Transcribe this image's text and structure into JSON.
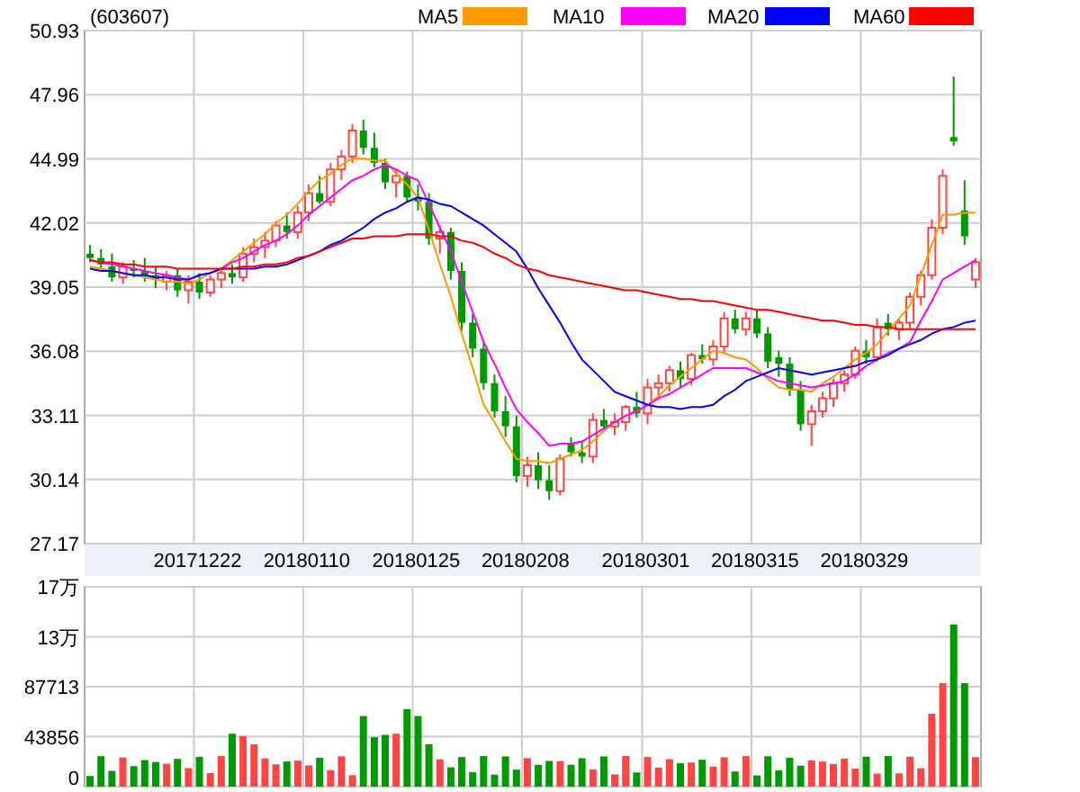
{
  "title": "(603607)",
  "price_chart": {
    "chart_data": {
      "type": "candlestick",
      "ylim": [
        27.17,
        50.93
      ],
      "grid": true,
      "categories": [
        null,
        null,
        null,
        null,
        null,
        null,
        null,
        null,
        null,
        null,
        "20171222",
        null,
        null,
        null,
        null,
        null,
        null,
        null,
        null,
        null,
        "20180110",
        null,
        null,
        null,
        null,
        null,
        null,
        null,
        null,
        null,
        "20180125",
        null,
        null,
        null,
        null,
        null,
        null,
        null,
        null,
        null,
        "20180208",
        null,
        null,
        null,
        null,
        null,
        null,
        null,
        null,
        null,
        null,
        "20180301",
        null,
        null,
        null,
        null,
        null,
        null,
        null,
        null,
        null,
        "20180315",
        null,
        null,
        null,
        null,
        null,
        null,
        null,
        null,
        null,
        "20180329",
        null,
        null,
        null,
        null,
        null,
        null,
        null,
        null,
        null,
        null
      ],
      "yticks": [
        {
          "value": 50.93,
          "label": "50.93"
        },
        {
          "value": 47.96,
          "label": "47.96"
        },
        {
          "value": 44.99,
          "label": "44.99"
        },
        {
          "value": 42.02,
          "label": "42.02"
        },
        {
          "value": 39.05,
          "label": "39.05"
        },
        {
          "value": 36.08,
          "label": "36.08"
        },
        {
          "value": 33.11,
          "label": "33.11"
        },
        {
          "value": 30.14,
          "label": "30.14"
        },
        {
          "value": 27.17,
          "label": "27.17"
        }
      ],
      "ohlc": [
        [
          40.6,
          41.0,
          40.2,
          40.4
        ],
        [
          40.4,
          40.8,
          39.9,
          40.1
        ],
        [
          40.0,
          40.6,
          39.3,
          39.5
        ],
        [
          39.5,
          40.2,
          39.2,
          40.0
        ],
        [
          39.9,
          40.3,
          39.5,
          39.8
        ],
        [
          39.8,
          40.4,
          39.3,
          39.6
        ],
        [
          39.6,
          40.0,
          39.0,
          39.4
        ],
        [
          39.3,
          39.8,
          38.9,
          39.6
        ],
        [
          39.6,
          39.9,
          38.6,
          38.9
        ],
        [
          38.9,
          39.6,
          38.3,
          39.3
        ],
        [
          39.3,
          39.7,
          38.5,
          38.8
        ],
        [
          38.8,
          39.6,
          38.6,
          39.4
        ],
        [
          39.4,
          39.9,
          39.0,
          39.7
        ],
        [
          39.7,
          40.1,
          39.2,
          39.5
        ],
        [
          39.5,
          40.9,
          39.3,
          40.6
        ],
        [
          40.6,
          41.3,
          40.2,
          40.9
        ],
        [
          40.9,
          41.6,
          40.4,
          41.2
        ],
        [
          41.2,
          42.1,
          40.9,
          41.9
        ],
        [
          41.9,
          42.5,
          41.3,
          41.6
        ],
        [
          41.6,
          42.8,
          41.3,
          42.5
        ],
        [
          42.5,
          43.8,
          42.1,
          43.4
        ],
        [
          43.4,
          44.2,
          42.9,
          43.0
        ],
        [
          43.0,
          44.8,
          42.8,
          44.5
        ],
        [
          44.5,
          45.4,
          44.0,
          45.1
        ],
        [
          45.1,
          46.6,
          44.8,
          46.3
        ],
        [
          46.3,
          46.8,
          45.2,
          45.5
        ],
        [
          45.5,
          46.2,
          44.6,
          44.8
        ],
        [
          44.8,
          45.0,
          43.6,
          43.9
        ],
        [
          43.9,
          44.5,
          43.2,
          44.2
        ],
        [
          44.2,
          44.4,
          43.0,
          43.2
        ],
        [
          43.2,
          43.8,
          42.6,
          43.0
        ],
        [
          43.0,
          43.4,
          41.0,
          41.3
        ],
        [
          41.3,
          41.9,
          40.6,
          41.6
        ],
        [
          41.6,
          41.8,
          39.4,
          39.8
        ],
        [
          39.8,
          40.2,
          37.0,
          37.4
        ],
        [
          37.4,
          37.8,
          35.8,
          36.2
        ],
        [
          36.2,
          36.6,
          34.3,
          34.6
        ],
        [
          34.6,
          35.0,
          33.0,
          33.3
        ],
        [
          33.3,
          34.0,
          32.1,
          32.6
        ],
        [
          32.6,
          33.1,
          30.0,
          30.3
        ],
        [
          30.3,
          31.2,
          29.8,
          30.8
        ],
        [
          30.8,
          31.4,
          29.7,
          30.1
        ],
        [
          30.1,
          30.8,
          29.2,
          29.6
        ],
        [
          29.6,
          31.3,
          29.4,
          31.1
        ],
        [
          31.8,
          32.1,
          31.2,
          31.4
        ],
        [
          31.4,
          31.9,
          30.9,
          31.2
        ],
        [
          31.2,
          33.2,
          30.9,
          32.9
        ],
        [
          32.9,
          33.4,
          32.4,
          32.6
        ],
        [
          32.6,
          33.2,
          32.2,
          32.8
        ],
        [
          32.8,
          33.6,
          32.4,
          33.5
        ],
        [
          33.5,
          34.2,
          33.0,
          33.2
        ],
        [
          33.2,
          34.8,
          32.7,
          34.4
        ],
        [
          34.4,
          35.0,
          33.9,
          34.6
        ],
        [
          34.6,
          35.4,
          34.2,
          35.2
        ],
        [
          35.2,
          35.6,
          34.4,
          34.8
        ],
        [
          34.8,
          36.0,
          34.5,
          35.9
        ],
        [
          35.9,
          36.4,
          35.5,
          35.7
        ],
        [
          35.7,
          36.6,
          35.4,
          36.3
        ],
        [
          36.3,
          37.9,
          36.0,
          37.6
        ],
        [
          37.6,
          38.0,
          36.9,
          37.1
        ],
        [
          37.1,
          37.9,
          36.8,
          37.6
        ],
        [
          37.6,
          38.0,
          36.7,
          36.9
        ],
        [
          36.9,
          37.2,
          35.3,
          35.6
        ],
        [
          35.8,
          36.1,
          34.9,
          35.5
        ],
        [
          35.5,
          35.8,
          34.0,
          34.3
        ],
        [
          34.3,
          34.7,
          32.4,
          32.7
        ],
        [
          32.7,
          33.6,
          31.7,
          33.3
        ],
        [
          33.3,
          34.2,
          33.0,
          33.9
        ],
        [
          33.9,
          34.8,
          33.5,
          34.6
        ],
        [
          34.6,
          35.2,
          34.2,
          35.0
        ],
        [
          35.0,
          36.3,
          34.8,
          36.1
        ],
        [
          36.1,
          36.6,
          35.5,
          35.8
        ],
        [
          35.8,
          37.6,
          35.6,
          37.2
        ],
        [
          37.4,
          37.8,
          36.8,
          37.1
        ],
        [
          37.1,
          37.6,
          36.6,
          37.4
        ],
        [
          37.4,
          38.8,
          37.1,
          38.6
        ],
        [
          38.6,
          39.8,
          38.2,
          39.6
        ],
        [
          39.6,
          42.2,
          39.4,
          41.8
        ],
        [
          41.8,
          44.5,
          41.5,
          44.2
        ],
        [
          46.0,
          48.8,
          45.6,
          45.8
        ],
        [
          42.6,
          44.0,
          41.0,
          41.4
        ],
        [
          39.4,
          40.4,
          39.0,
          40.2
        ]
      ]
    }
  },
  "moving_averages": {
    "chart_data": {
      "type": "line",
      "ylim": [
        27.17,
        50.93
      ],
      "legend": true,
      "series": [
        {
          "name": "MA5",
          "color": "#ff9900",
          "values": [
            40.0,
            39.9,
            39.8,
            39.7,
            39.6,
            39.5,
            39.4,
            39.3,
            39.3,
            39.2,
            39.4,
            39.7,
            39.9,
            40.3,
            40.7,
            41.1,
            41.5,
            42.0,
            42.4,
            42.9,
            43.5,
            44.0,
            44.3,
            44.7,
            45.0,
            45.0,
            44.9,
            44.9,
            44.3,
            43.8,
            43.2,
            41.7,
            40.1,
            38.6,
            36.9,
            35.3,
            33.6,
            32.8,
            31.9,
            31.1,
            31.0,
            31.0,
            30.9,
            31.1,
            31.3,
            31.5,
            31.9,
            32.4,
            32.8,
            33.1,
            33.3,
            33.6,
            34.0,
            34.5,
            34.9,
            35.3,
            35.7,
            36.1,
            36.0,
            35.8,
            35.7,
            35.3,
            34.8,
            34.4,
            34.3,
            34.3,
            34.2,
            34.6,
            34.9,
            35.3,
            35.7,
            36.0,
            36.4,
            37.0,
            37.6,
            38.2,
            39.6,
            41.0,
            42.4,
            42.4,
            42.5,
            42.5
          ]
        },
        {
          "name": "MA10",
          "color": "#ff00ff",
          "values": [
            40.3,
            40.2,
            40.1,
            40.0,
            39.9,
            39.8,
            39.7,
            39.6,
            39.5,
            39.4,
            39.6,
            39.7,
            39.9,
            40.2,
            40.4,
            40.7,
            41.0,
            41.2,
            41.5,
            41.9,
            42.4,
            42.8,
            43.2,
            43.6,
            44.0,
            44.2,
            44.5,
            44.7,
            44.5,
            44.2,
            44.0,
            42.9,
            41.8,
            40.7,
            39.3,
            37.9,
            36.5,
            35.5,
            34.4,
            33.4,
            32.8,
            32.3,
            31.7,
            31.8,
            31.8,
            31.9,
            32.2,
            32.5,
            32.8,
            33.1,
            33.3,
            33.6,
            33.9,
            34.1,
            34.4,
            34.7,
            35.0,
            35.3,
            35.3,
            35.3,
            35.3,
            35.1,
            34.9,
            34.7,
            34.6,
            34.5,
            34.4,
            34.5,
            34.6,
            34.7,
            35.0,
            35.4,
            35.7,
            36.0,
            36.2,
            36.5,
            37.5,
            38.4,
            39.4,
            39.7,
            40.0,
            40.3
          ]
        },
        {
          "name": "MA20",
          "color": "#0000ff",
          "values": [
            39.9,
            39.8,
            39.8,
            39.7,
            39.6,
            39.6,
            39.5,
            39.5,
            39.4,
            39.4,
            39.6,
            39.7,
            39.9,
            39.9,
            39.9,
            39.9,
            40.0,
            40.0,
            40.1,
            40.3,
            40.5,
            40.7,
            41.0,
            41.2,
            41.5,
            41.8,
            42.2,
            42.5,
            42.7,
            43.0,
            43.2,
            43.1,
            42.9,
            42.8,
            42.5,
            42.2,
            41.9,
            41.5,
            41.1,
            40.7,
            39.9,
            39.0,
            38.2,
            37.4,
            36.5,
            35.7,
            35.2,
            34.7,
            34.2,
            34.0,
            33.8,
            33.6,
            33.5,
            33.5,
            33.4,
            33.5,
            33.5,
            33.6,
            34.0,
            34.3,
            34.7,
            34.9,
            35.1,
            35.3,
            35.2,
            35.1,
            35.0,
            35.1,
            35.2,
            35.3,
            35.4,
            35.6,
            35.7,
            35.9,
            36.2,
            36.4,
            36.6,
            36.9,
            37.1,
            37.2,
            37.4,
            37.5
          ]
        },
        {
          "name": "MA60",
          "color": "#ff0000",
          "values": [
            40.3,
            40.2,
            40.2,
            40.1,
            40.1,
            40.0,
            40.0,
            40.0,
            39.9,
            39.9,
            39.9,
            39.9,
            39.9,
            39.9,
            40.0,
            40.0,
            40.1,
            40.1,
            40.2,
            40.4,
            40.5,
            40.7,
            40.9,
            41.1,
            41.3,
            41.3,
            41.4,
            41.4,
            41.4,
            41.5,
            41.5,
            41.5,
            41.4,
            41.4,
            41.2,
            41.1,
            40.9,
            40.6,
            40.4,
            40.1,
            39.9,
            39.8,
            39.6,
            39.5,
            39.4,
            39.3,
            39.2,
            39.1,
            39.0,
            38.9,
            38.9,
            38.8,
            38.7,
            38.6,
            38.5,
            38.5,
            38.4,
            38.4,
            38.3,
            38.2,
            38.1,
            38.0,
            38.0,
            37.9,
            37.8,
            37.7,
            37.6,
            37.5,
            37.5,
            37.4,
            37.3,
            37.3,
            37.2,
            37.2,
            37.1,
            37.1,
            37.1,
            37.1,
            37.1,
            37.1,
            37.1,
            37.1
          ]
        }
      ]
    }
  },
  "volume_axis": {
    "ticks": [
      "17万",
      "13万",
      "87713",
      "43856",
      "0"
    ]
  }
}
